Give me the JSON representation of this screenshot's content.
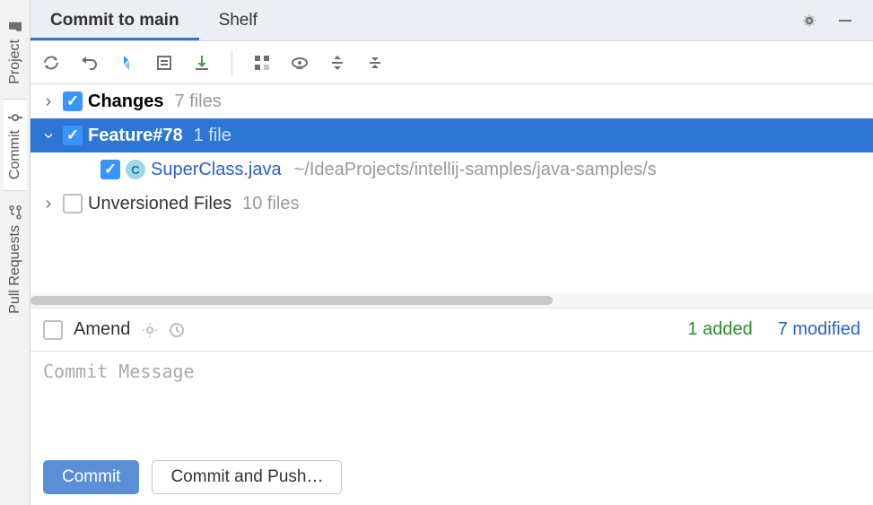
{
  "sideTabs": {
    "project": "Project",
    "commit": "Commit",
    "pull": "Pull Requests"
  },
  "tabs": {
    "commit_to": "Commit to main",
    "shelf": "Shelf"
  },
  "tree": {
    "changes": {
      "label": "Changes",
      "count": "7 files"
    },
    "feature": {
      "label": "Feature#78",
      "count": "1 file"
    },
    "file": {
      "icon": "C",
      "name": "SuperClass.java",
      "path": "~/IdeaProjects/intellij-samples/java-samples/s"
    },
    "unversioned": {
      "label": "Unversioned Files",
      "count": "10 files"
    }
  },
  "amend": {
    "label": "Amend",
    "added": "1 added",
    "modified": "7 modified"
  },
  "commitMessage": {
    "placeholder": "Commit Message"
  },
  "buttons": {
    "commit": "Commit",
    "commitPush": "Commit and Push…"
  }
}
